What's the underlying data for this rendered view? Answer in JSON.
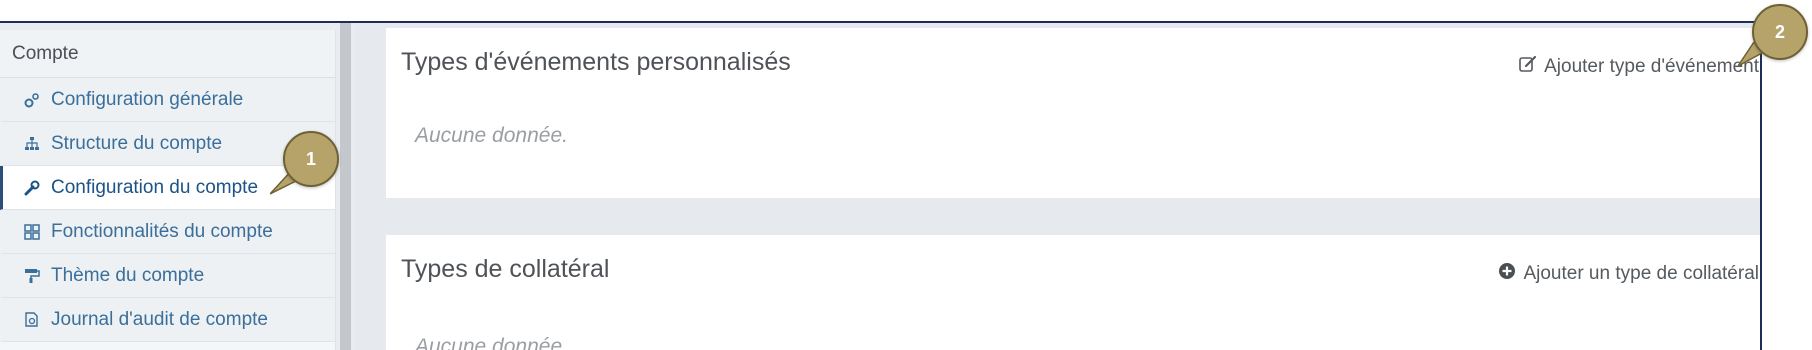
{
  "sidebar": {
    "header": "Compte",
    "items": [
      {
        "label": "Configuration générale",
        "icon": "gears-icon"
      },
      {
        "label": "Structure du compte",
        "icon": "sitemap-icon"
      },
      {
        "label": "Configuration du compte",
        "icon": "wrench-icon",
        "active": true
      },
      {
        "label": "Fonctionnalités du compte",
        "icon": "features-icon"
      },
      {
        "label": "Thème du compte",
        "icon": "paint-roller-icon"
      },
      {
        "label": "Journal d'audit de compte",
        "icon": "audit-log-icon"
      }
    ]
  },
  "panels": [
    {
      "title": "Types d'événements personnalisés",
      "action": "Ajouter type d'événement",
      "action_icon": "edit-icon",
      "empty": "Aucune donnée."
    },
    {
      "title": "Types de collatéral",
      "action": "Ajouter un type de collatéral",
      "action_icon": "plus-circle-icon",
      "empty": "Aucune donnée."
    }
  ],
  "markers": [
    "1",
    "2"
  ],
  "colors": {
    "accent": "#1b5386",
    "marker": "#b6a36a",
    "frame": "#1f2d5a"
  }
}
